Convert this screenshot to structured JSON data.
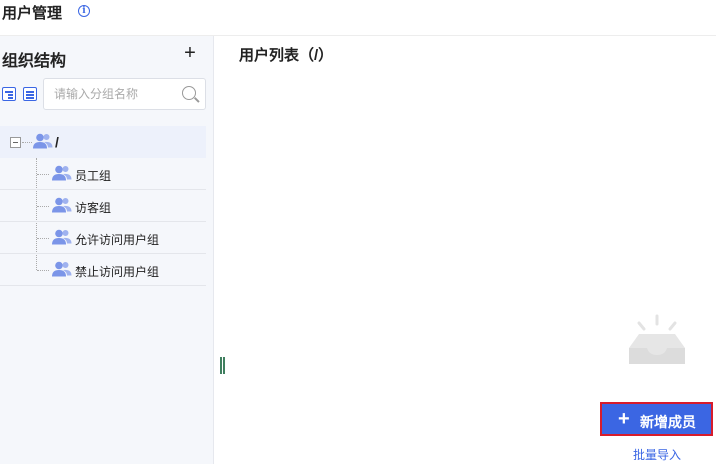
{
  "header": {
    "title": "用户管理",
    "info_icon": "info-circle-icon"
  },
  "sidebar": {
    "title": "组织结构",
    "add_icon": "plus-icon",
    "expand_tree_icon": "tree-expand-icon",
    "collapse_tree_icon": "tree-collapse-icon",
    "search": {
      "placeholder": "请输入分组名称",
      "value": ""
    },
    "tree": {
      "root": {
        "label": "/",
        "expanded": true
      },
      "children": [
        {
          "label": "员工组"
        },
        {
          "label": "访客组"
        },
        {
          "label": "允许访问用户组"
        },
        {
          "label": "禁止访问用户组"
        }
      ]
    }
  },
  "main": {
    "title": "用户列表（/）",
    "empty_icon": "empty-inbox-icon",
    "add_member_label": "新增成员",
    "batch_import_label": "批量导入"
  },
  "colors": {
    "accent": "#3b66e3",
    "group_icon": "#7b95e8",
    "highlight_border": "#d71c2c",
    "sidebar_bg": "#f5f7fb"
  }
}
